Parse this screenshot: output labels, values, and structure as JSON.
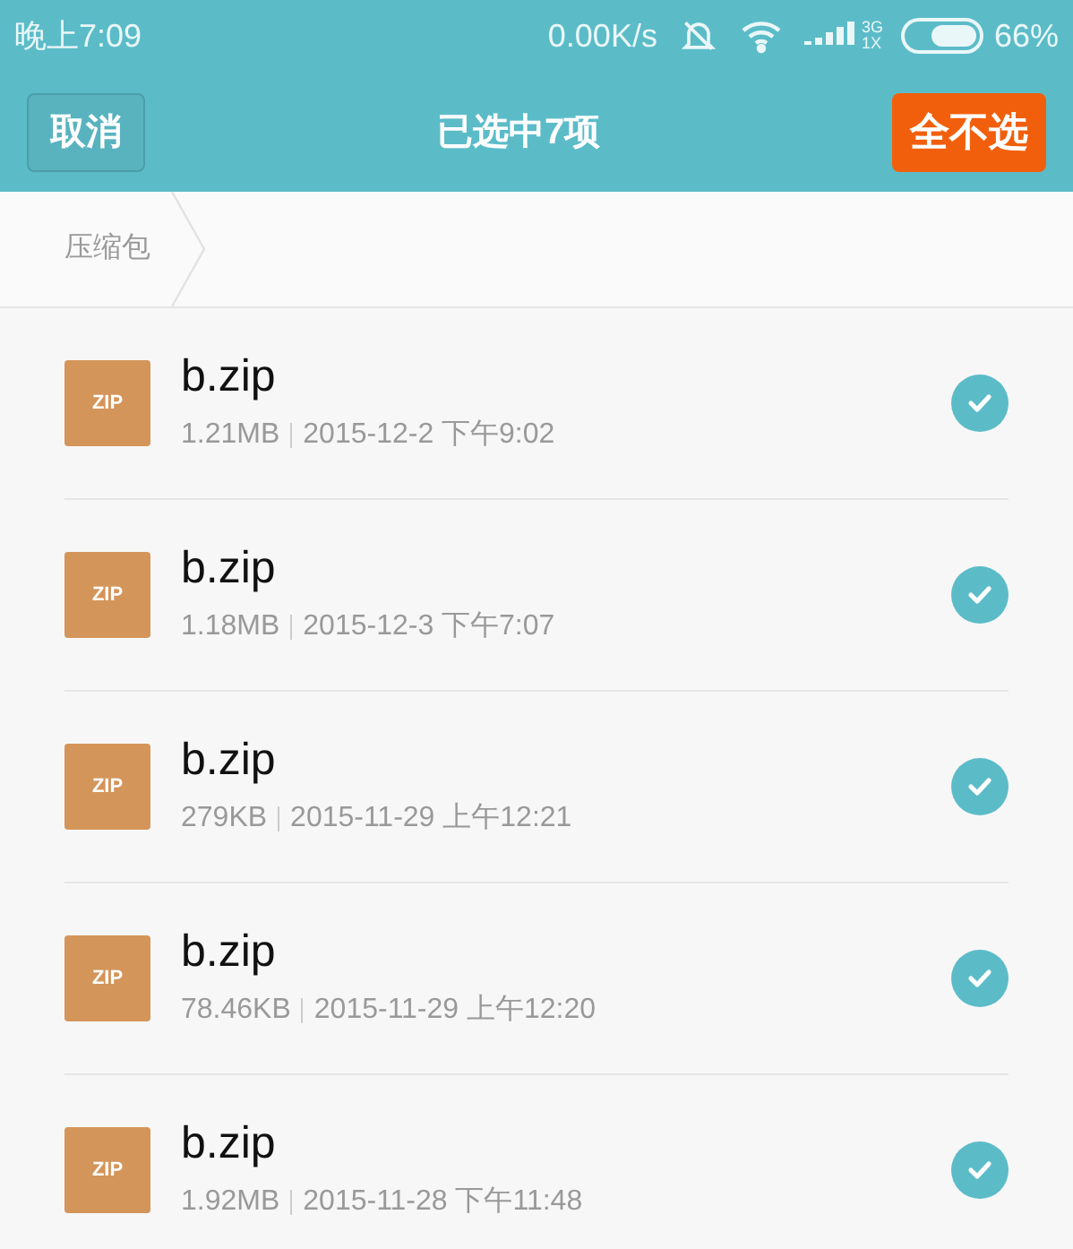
{
  "status_bar": {
    "time": "晚上7:09",
    "speed": "0.00K/s",
    "network_top": "3G",
    "network_bottom": "1X",
    "battery": "66%"
  },
  "toolbar": {
    "cancel": "取消",
    "title": "已选中7项",
    "deselect_all": "全不选"
  },
  "breadcrumb": [
    "压缩包"
  ],
  "files": [
    {
      "type": "ZIP",
      "name": "b.zip",
      "size": "1.21MB",
      "date": "2015-12-2 下午9:02",
      "selected": true
    },
    {
      "type": "ZIP",
      "name": "b.zip",
      "size": "1.18MB",
      "date": "2015-12-3 下午7:07",
      "selected": true
    },
    {
      "type": "ZIP",
      "name": "b.zip",
      "size": "279KB",
      "date": "2015-11-29 上午12:21",
      "selected": true
    },
    {
      "type": "ZIP",
      "name": "b.zip",
      "size": "78.46KB",
      "date": "2015-11-29 上午12:20",
      "selected": true
    },
    {
      "type": "ZIP",
      "name": "b.zip",
      "size": "1.92MB",
      "date": "2015-11-28 下午11:48",
      "selected": true
    }
  ]
}
